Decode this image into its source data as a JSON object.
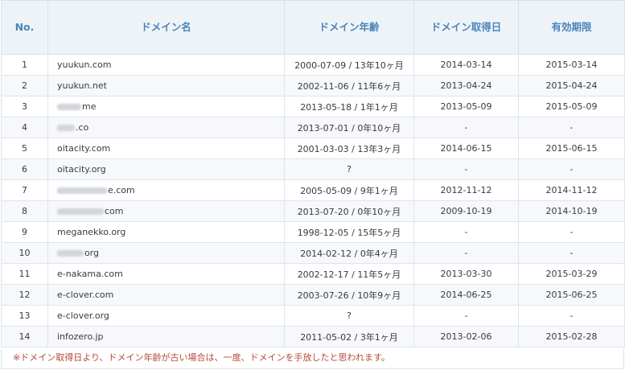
{
  "table": {
    "headers": [
      "No.",
      "ドメイン名",
      "ドメイン年齢",
      "ドメイン取得日",
      "有効期限"
    ],
    "rows": [
      {
        "no": "1",
        "domain": "yuukun.com",
        "age": "2000-07-09 / 13年10ヶ月",
        "acquired": "2014-03-14",
        "expires": "2015-03-14",
        "blur": 0
      },
      {
        "no": "2",
        "domain": "yuukun.net",
        "age": "2002-11-06 / 11年6ヶ月",
        "acquired": "2013-04-24",
        "expires": "2015-04-24",
        "blur": 0
      },
      {
        "no": "3",
        "domain": "me",
        "age": "2013-05-18 / 1年1ヶ月",
        "acquired": "2013-05-09",
        "expires": "2015-05-09",
        "blur": 30
      },
      {
        "no": "4",
        "domain": ".co",
        "age": "2013-07-01 / 0年10ヶ月",
        "acquired": "-",
        "expires": "-",
        "blur": 22
      },
      {
        "no": "5",
        "domain": "oitacity.com",
        "age": "2001-03-03 / 13年3ヶ月",
        "acquired": "2014-06-15",
        "expires": "2015-06-15",
        "blur": 0
      },
      {
        "no": "6",
        "domain": "oitacity.org",
        "age": "?",
        "acquired": "-",
        "expires": "-",
        "blur": 0
      },
      {
        "no": "7",
        "domain": "e.com",
        "age": "2005-05-09 / 9年1ヶ月",
        "acquired": "2012-11-12",
        "expires": "2014-11-12",
        "blur": 62
      },
      {
        "no": "8",
        "domain": "com",
        "age": "2013-07-20 / 0年10ヶ月",
        "acquired": "2009-10-19",
        "expires": "2014-10-19",
        "blur": 58
      },
      {
        "no": "9",
        "domain": "meganekko.org",
        "age": "1998-12-05 / 15年5ヶ月",
        "acquired": "-",
        "expires": "-",
        "blur": 0
      },
      {
        "no": "10",
        "domain": "org",
        "age": "2014-02-12 / 0年4ヶ月",
        "acquired": "-",
        "expires": "-",
        "blur": 33
      },
      {
        "no": "11",
        "domain": "e-nakama.com",
        "age": "2002-12-17 / 11年5ヶ月",
        "acquired": "2013-03-30",
        "expires": "2015-03-29",
        "blur": 0
      },
      {
        "no": "12",
        "domain": "e-clover.com",
        "age": "2003-07-26 / 10年9ヶ月",
        "acquired": "2014-06-25",
        "expires": "2015-06-25",
        "blur": 0
      },
      {
        "no": "13",
        "domain": "e-clover.org",
        "age": "?",
        "acquired": "-",
        "expires": "-",
        "blur": 0
      },
      {
        "no": "14",
        "domain": "infozero.jp",
        "age": "2011-05-02 / 3年1ヶ月",
        "acquired": "2013-02-06",
        "expires": "2015-02-28",
        "blur": 0
      }
    ]
  },
  "note": "※ドメイン取得日より、ドメイン年齢が古い場合は、一度、ドメインを手放したと思われます。"
}
